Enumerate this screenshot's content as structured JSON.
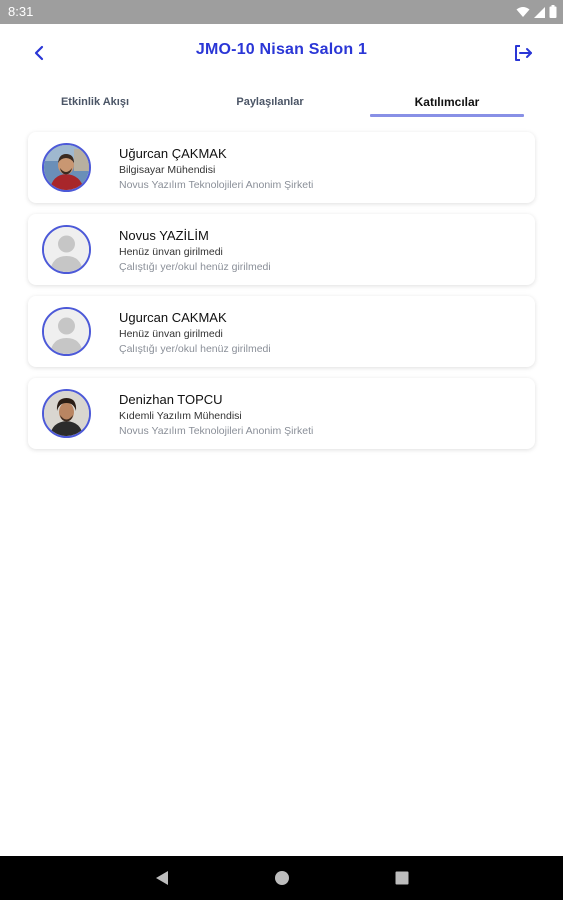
{
  "status_bar": {
    "time": "8:31"
  },
  "header": {
    "title": "JMO-10 Nisan Salon 1",
    "back_icon": "chevron-left-icon",
    "logout_icon": "logout-icon",
    "accent_color": "#2a36d6"
  },
  "tabs": [
    {
      "label": "Etkinlik Akışı",
      "active": false
    },
    {
      "label": "Paylaşılanlar",
      "active": false
    },
    {
      "label": "Katılımcılar",
      "active": true
    }
  ],
  "participants": [
    {
      "name": "Uğurcan ÇAKMAK",
      "title": "Bilgisayar Mühendisi",
      "company": "Novus Yazılım Teknolojileri Anonim Şirketi",
      "avatar": "photo"
    },
    {
      "name": "Novus YAZİLİM",
      "title": "Henüz ünvan girilmedi",
      "company": "Çalıştığı yer/okul henüz girilmedi",
      "avatar": "placeholder"
    },
    {
      "name": "Ugurcan CAKMAK",
      "title": "Henüz ünvan girilmedi",
      "company": "Çalıştığı yer/okul henüz girilmedi",
      "avatar": "placeholder"
    },
    {
      "name": "Denizhan TOPCU",
      "title": "Kıdemli Yazılım Mühendisi",
      "company": "Novus Yazılım Teknolojileri Anonim Şirketi",
      "avatar": "photo"
    }
  ]
}
